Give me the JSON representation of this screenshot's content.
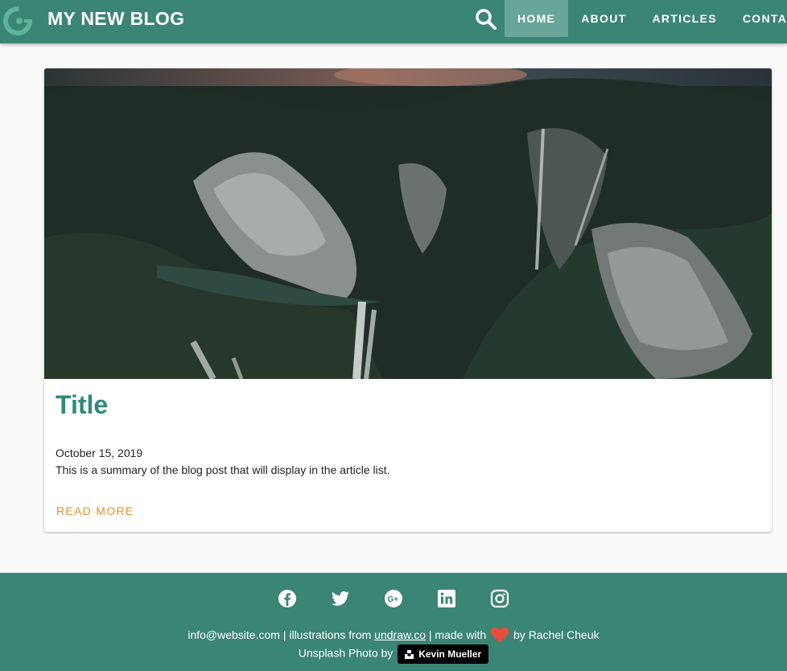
{
  "header": {
    "brand": "MY NEW BLOG",
    "nav": [
      {
        "label": "HOME",
        "active": true
      },
      {
        "label": "ABOUT",
        "active": false
      },
      {
        "label": "ARTICLES",
        "active": false
      },
      {
        "label": "CONTACT",
        "active": false
      }
    ],
    "icons": [
      "logo-icon",
      "search-icon"
    ]
  },
  "article": {
    "title": "Title",
    "date": "October 15, 2019",
    "summary": "This is a summary of the blog post that will display in the article list.",
    "read_more": "READ MORE"
  },
  "footer": {
    "social": [
      "facebook-icon",
      "twitter-icon",
      "google-plus-icon",
      "linkedin-icon",
      "instagram-icon"
    ],
    "email": "info@website.com",
    "illustrations_text": " | illustrations from ",
    "illustrations_link": "undraw.co",
    "made_with": " | made with ",
    "by": " by Rachel Cheuk",
    "photo_text": "Unsplash Photo by",
    "photographer": "Kevin Mueller"
  },
  "colors": {
    "primary": "#3b8575",
    "nav_active": "#67a698",
    "title": "#2e8b7b",
    "accent": "#e98f2c",
    "heart": "#e74c3c"
  }
}
